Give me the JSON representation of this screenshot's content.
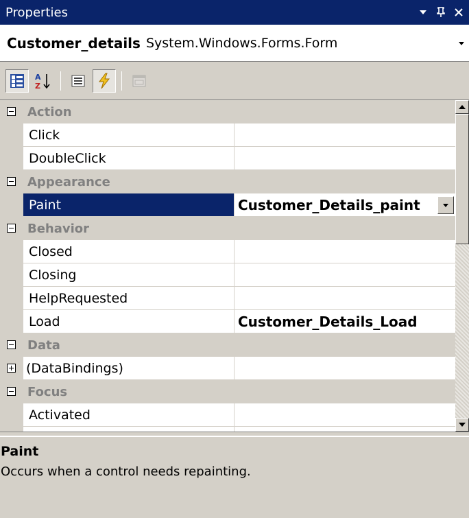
{
  "window": {
    "title": "Properties",
    "dropdown_icon": "chevron-down-icon",
    "pin_icon": "pin-icon",
    "close_icon": "close-icon"
  },
  "object_selector": {
    "name": "Customer_details",
    "type": "System.Windows.Forms.Form"
  },
  "toolbar": {
    "buttons": [
      {
        "icon": "categorized-icon",
        "pressed": true
      },
      {
        "icon": "alphabetical-sort-icon",
        "pressed": false
      },
      {
        "icon": "properties-icon",
        "pressed": false
      },
      {
        "icon": "events-lightning-icon",
        "pressed": true
      },
      {
        "icon": "property-pages-icon",
        "pressed": false,
        "disabled": true
      }
    ]
  },
  "grid": {
    "rows": [
      {
        "kind": "category",
        "label": "Action",
        "expanded": true
      },
      {
        "kind": "property",
        "label": "Click",
        "value": ""
      },
      {
        "kind": "property",
        "label": "DoubleClick",
        "value": ""
      },
      {
        "kind": "category",
        "label": "Appearance",
        "expanded": true
      },
      {
        "kind": "property",
        "label": "Paint",
        "value": "Customer_Details_paint",
        "selected": true
      },
      {
        "kind": "category",
        "label": "Behavior",
        "expanded": true
      },
      {
        "kind": "property",
        "label": "Closed",
        "value": ""
      },
      {
        "kind": "property",
        "label": "Closing",
        "value": ""
      },
      {
        "kind": "property",
        "label": "HelpRequested",
        "value": ""
      },
      {
        "kind": "property",
        "label": "Load",
        "value": "Customer_Details_Load"
      },
      {
        "kind": "category",
        "label": "Data",
        "expanded": true
      },
      {
        "kind": "property",
        "label": "(DataBindings)",
        "value": "",
        "expandable": true
      },
      {
        "kind": "category",
        "label": "Focus",
        "expanded": true
      },
      {
        "kind": "property",
        "label": "Activated",
        "value": ""
      }
    ]
  },
  "description": {
    "title": "Paint",
    "text": "Occurs when a control needs repainting."
  },
  "colors": {
    "title_bar": "#0a246a",
    "selection": "#0a246a",
    "chrome": "#d4d0c8"
  }
}
